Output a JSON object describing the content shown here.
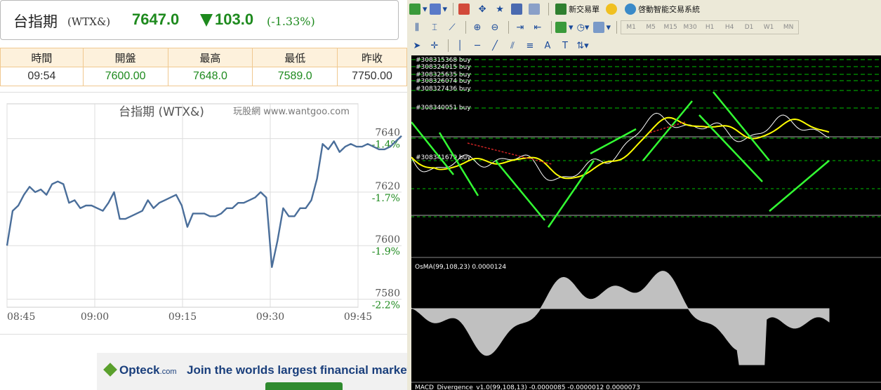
{
  "quote": {
    "name": "台指期",
    "code": "(WTX&)",
    "price": "7647.0",
    "change": "103.0",
    "pct": "(-1.33%)",
    "color_down": "#1e8a1e"
  },
  "table": {
    "headers": [
      "時間",
      "開盤",
      "最高",
      "最低",
      "昨收"
    ],
    "values": [
      "09:54",
      "7600.00",
      "7648.0",
      "7589.0",
      "7750.00"
    ]
  },
  "chart_data": {
    "type": "line",
    "title": "台指期 (WTX&)",
    "subtitle": "玩股網 www.wantgoo.com",
    "xlabel": "",
    "ylabel": "",
    "x_ticks": [
      "08:45",
      "09:00",
      "09:15",
      "09:30",
      "09:45"
    ],
    "y_ticks": [
      "7640",
      "7620",
      "7600",
      "7580"
    ],
    "pct_ticks": [
      "-1.4%",
      "-1.7%",
      "-1.9%",
      "-2.2%"
    ],
    "ylim": [
      7577,
      7653
    ],
    "grid": true,
    "line_color": "#4a6e9a",
    "series": [
      {
        "values": [
          7600,
          7613,
          7615,
          7619,
          7622,
          7620,
          7621,
          7619,
          7623,
          7624,
          7623,
          7616,
          7617,
          7614,
          7615,
          7615,
          7614,
          7613,
          7616,
          7620,
          7610,
          7610,
          7611,
          7612,
          7613,
          7617,
          7614,
          7616,
          7617,
          7618,
          7619,
          7615,
          7607,
          7612,
          7612,
          7612,
          7611,
          7611,
          7612,
          7614,
          7614,
          7616,
          7616,
          7617,
          7618,
          7620,
          7618,
          7592,
          7602,
          7614,
          7611,
          7611,
          7614,
          7614,
          7617,
          7625,
          7638,
          7636,
          7639,
          7635,
          7637,
          7638,
          7637,
          7637,
          7638,
          7637,
          7636,
          7636,
          7637,
          7639,
          7641
        ]
      }
    ]
  },
  "mt": {
    "toolbar1": {
      "new_order": "新交易單",
      "auto_trade": "啓動智能交易系統"
    },
    "timeframes": [
      "M1",
      "M5",
      "M15",
      "M30",
      "H1",
      "H4",
      "D1",
      "W1",
      "MN"
    ],
    "order_labels": [
      "#308315368 buy",
      "#308324015 buy",
      "#308325635 buy",
      "#308326074 buy",
      "#308327436 buy",
      "#308340051 buy",
      "#308341679 buy"
    ],
    "osma_label": "OsMA(99,108,23) 0.0000124",
    "macd_label": "MACD_Divergence_v1.0(99,108,13) -0.0000085 -0.0000012 0.0000073"
  },
  "ad": {
    "logo": "Opteck",
    "logo_suffix": ".com",
    "text": "Join the worlds largest financial market t"
  }
}
